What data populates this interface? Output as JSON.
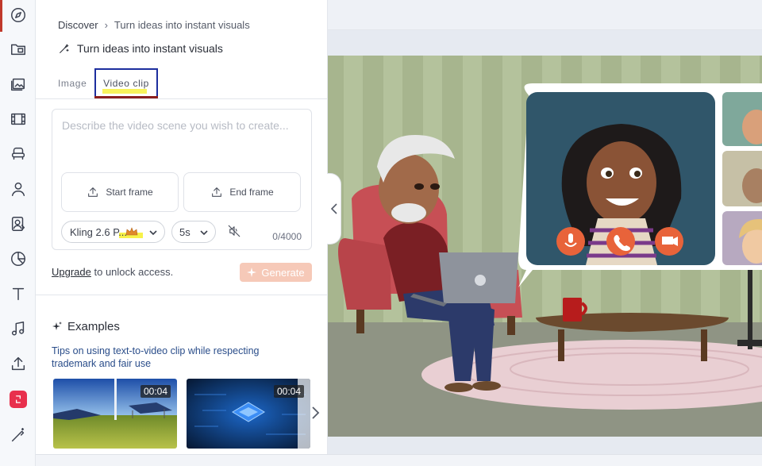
{
  "breadcrumb": {
    "root": "Discover",
    "current": "Turn ideas into instant visuals"
  },
  "panel_title": "Turn ideas into instant visuals",
  "tabs": [
    {
      "label": "Image"
    },
    {
      "label": "Video clip",
      "selected": true
    }
  ],
  "prompt": {
    "placeholder": "Describe the video scene you wish to create..."
  },
  "frames": {
    "start": "Start frame",
    "end": "End frame"
  },
  "model": {
    "selected": "Kling 2.6 P..."
  },
  "duration": {
    "selected": "5s"
  },
  "char_count": "0/4000",
  "upgrade": {
    "link": "Upgrade",
    "text": " to unlock access."
  },
  "generate_label": "Generate",
  "examples": {
    "heading": "Examples",
    "tip": "Tips on using text-to-video clip while respecting trademark and fair use",
    "thumbnails": [
      {
        "duration": "00:04"
      },
      {
        "duration": "00:04"
      }
    ]
  },
  "colors": {
    "accent": "#c0392b",
    "generate_bg": "#f6c9b8",
    "tab_outline": "#1d2e9e",
    "link": "#2a4d8a"
  },
  "icons": {
    "rail": [
      "compass-icon",
      "folder-icon",
      "image-icon",
      "film-icon",
      "chair-icon",
      "person-icon",
      "avatar-icon",
      "chart-icon",
      "text-icon",
      "music-icon",
      "upload-icon",
      "brand-icon",
      "magic-icon"
    ]
  }
}
